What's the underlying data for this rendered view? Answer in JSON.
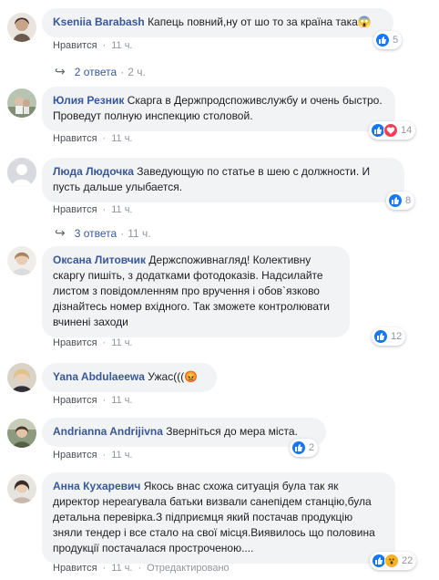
{
  "comments": [
    {
      "author": "Kseniia Barabash",
      "text": "Капець повний,ну от шо то за країна така😱",
      "like": "Нравится",
      "time": "11 ч.",
      "reactions": {
        "count": "5"
      }
    },
    {
      "author": "Юлия Резник",
      "text": "Скарга в Держпродспоживслужбу и очень быстро. Проведут полную инспекцию столовой.",
      "like": "Нравится",
      "time": "11 ч.",
      "reactions": {
        "count": "14"
      }
    },
    {
      "author": "Люда Людочка",
      "text": "Заведующую по статье в шею с должности. И пусть дальше улыбается.",
      "like": "Нравится",
      "time": "11 ч.",
      "reactions": {
        "count": "8"
      }
    },
    {
      "author": "Оксана Литовчик",
      "text": "Держспоживнагляд! Колективну скаргу пишіть, з додатками фотодоказів. Надсилайте листом з повідомленням про вручення і обов`язково дізнайтесь номер вхідного. Так зможете контролювати вчинені заходи",
      "like": "Нравится",
      "time": "11 ч.",
      "reactions": {
        "count": "12"
      }
    },
    {
      "author": "Yana Abdulaeewa",
      "text": "Ужас(((😡",
      "like": "Нравится",
      "time": "11 ч."
    },
    {
      "author": "Andrianna Andrijivna",
      "text": "Зверніться до мера міста.",
      "like": "Нравится",
      "time": "11 ч.",
      "reactions": {
        "count": "2"
      }
    },
    {
      "author": "Анна Кухаревич",
      "text": "Якось внас схожа ситуація була так як директор нереагувала батьки визвали санепідем станцію,була детальна перевірка.З підприємця який постачав продукцію зняли тендер і все стало на свої місця.Виявилось що половина продукції постачалася простроченою....",
      "like": "Нравится",
      "time": "11 ч.",
      "edited": "Отредактировано",
      "reactions": {
        "count": "22"
      }
    }
  ],
  "reply_threads": [
    {
      "label": "2 ответа",
      "time": "2 ч."
    },
    {
      "label": "3 ответа",
      "time": "11 ч."
    }
  ],
  "icons": {
    "like": "thumbs-up-icon",
    "love": "heart-icon",
    "wow": "wow-icon",
    "reply_arrow": "reply-arrow-icon"
  },
  "colors": {
    "author": "#385898",
    "bubble": "#f2f3f5",
    "like": "#1877f2",
    "love": "#f33e58",
    "wow": "#f7b125",
    "meta": "#90949c"
  }
}
